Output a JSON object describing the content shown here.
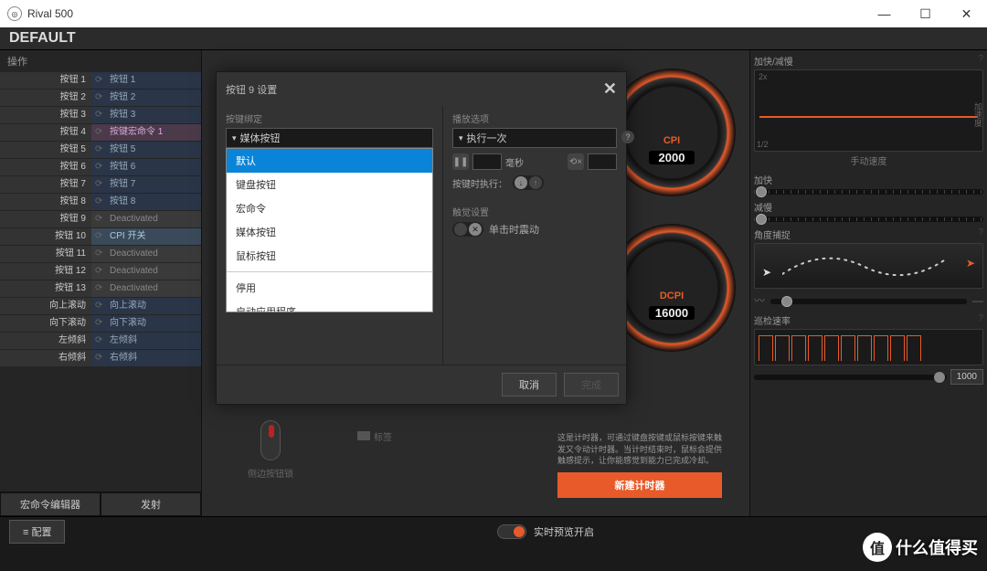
{
  "window": {
    "title": "Rival 500",
    "min": "—",
    "max": "☐",
    "close": "✕"
  },
  "header": {
    "profile": "DEFAULT"
  },
  "left": {
    "title": "操作",
    "rows": [
      {
        "label": "按钮 1",
        "value": "按钮 1",
        "cls": ""
      },
      {
        "label": "按钮 2",
        "value": "按钮 2",
        "cls": ""
      },
      {
        "label": "按钮 3",
        "value": "按钮 3",
        "cls": ""
      },
      {
        "label": "按钮 4",
        "value": "按键宏命令 1",
        "cls": "macro"
      },
      {
        "label": "按钮 5",
        "value": "按钮 5",
        "cls": ""
      },
      {
        "label": "按钮 6",
        "value": "按钮 6",
        "cls": ""
      },
      {
        "label": "按钮 7",
        "value": "按钮 7",
        "cls": ""
      },
      {
        "label": "按钮 8",
        "value": "按钮 8",
        "cls": ""
      },
      {
        "label": "按钮 9",
        "value": "Deactivated",
        "cls": "deact"
      },
      {
        "label": "按钮 10",
        "value": "CPI 开关",
        "cls": "cpi"
      },
      {
        "label": "按钮 11",
        "value": "Deactivated",
        "cls": "deact"
      },
      {
        "label": "按钮 12",
        "value": "Deactivated",
        "cls": "deact"
      },
      {
        "label": "按钮 13",
        "value": "Deactivated",
        "cls": "deact"
      },
      {
        "label": "向上滚动",
        "value": "向上滚动",
        "cls": ""
      },
      {
        "label": "向下滚动",
        "value": "向下滚动",
        "cls": ""
      },
      {
        "label": "左倾斜",
        "value": "左倾斜",
        "cls": ""
      },
      {
        "label": "右倾斜",
        "value": "右倾斜",
        "cls": ""
      }
    ],
    "macro_editor": "宏命令编辑器",
    "launch": "发射"
  },
  "center": {
    "side_lock_label": "侧边按钮锁",
    "tag_label": "标签"
  },
  "gauges": {
    "cpi_label": "CPI",
    "cpi_value": "2000",
    "dcpi_label": "DCPI",
    "dcpi_value": "16000"
  },
  "timer": {
    "desc": "这是计时器，可通过键盘按键或鼠标按键来触发又令动计时器。当计时结束时，鼠标会提供触感提示，让你能感觉到能力已完成冷却。",
    "button": "新建计时器"
  },
  "right": {
    "accel_title": "加快/减慢",
    "accel_y": "加速度",
    "accel_caption": "手动速度",
    "accel_2x": "2x",
    "accel_12": "1/2",
    "faster": "加快",
    "slower": "减慢",
    "angle_title": "角度捕捉",
    "poll_title": "巡检速率",
    "poll_value": "1000"
  },
  "modal": {
    "title": "按钮 9 设置",
    "binding_label": "按键绑定",
    "binding_value": "媒体按钮",
    "dropdown": [
      "默认",
      "键盘按钮",
      "宏命令",
      "媒体按钮",
      "鼠标按钮",
      "停用",
      "启动应用程序"
    ],
    "selected_index": 0,
    "playback_label": "播放选项",
    "playback_value": "执行一次",
    "ms_label": "毫秒",
    "exec_label": "按键时执行：",
    "haptic_label": "触觉设置",
    "haptic_value": "单击时震动",
    "cancel": "取消",
    "done": "完成"
  },
  "bottom": {
    "config": "≡  配置",
    "preview": "实时预览开启"
  },
  "watermark": {
    "icon": "值",
    "text": "什么值得买"
  }
}
